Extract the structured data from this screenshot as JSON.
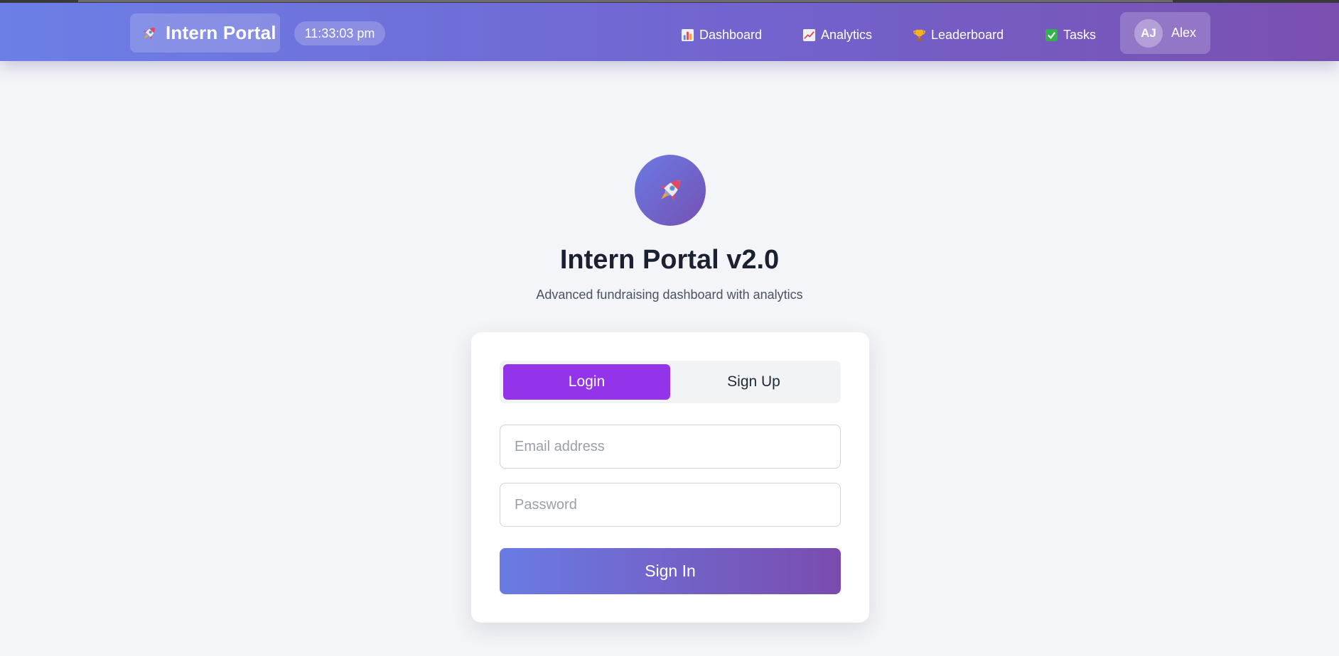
{
  "navbar": {
    "brand": "Intern Portal",
    "brand_icon": "rocket-icon",
    "clock": "11:33:03 pm",
    "items": [
      {
        "label": "Dashboard",
        "icon": "bar-chart-icon"
      },
      {
        "label": "Analytics",
        "icon": "trending-up-icon"
      },
      {
        "label": "Leaderboard",
        "icon": "trophy-icon"
      },
      {
        "label": "Tasks",
        "icon": "check-box-icon"
      }
    ],
    "user": {
      "initials": "AJ",
      "name": "Alex"
    }
  },
  "hero": {
    "icon": "rocket-icon",
    "title": "Intern Portal v2.0",
    "subtitle": "Advanced fundraising dashboard with analytics"
  },
  "auth": {
    "tabs": [
      {
        "label": "Login",
        "active": true
      },
      {
        "label": "Sign Up",
        "active": false
      }
    ],
    "email_placeholder": "Email address",
    "email_value": "",
    "password_placeholder": "Password",
    "password_value": "",
    "submit_label": "Sign In"
  },
  "colors": {
    "navbar_start": "#6b7fe6",
    "navbar_end": "#7a4fb0",
    "active_tab": "#9333ea",
    "button_start": "#6a7be4",
    "button_end": "#7a4caf",
    "background": "#f4f5f8"
  }
}
